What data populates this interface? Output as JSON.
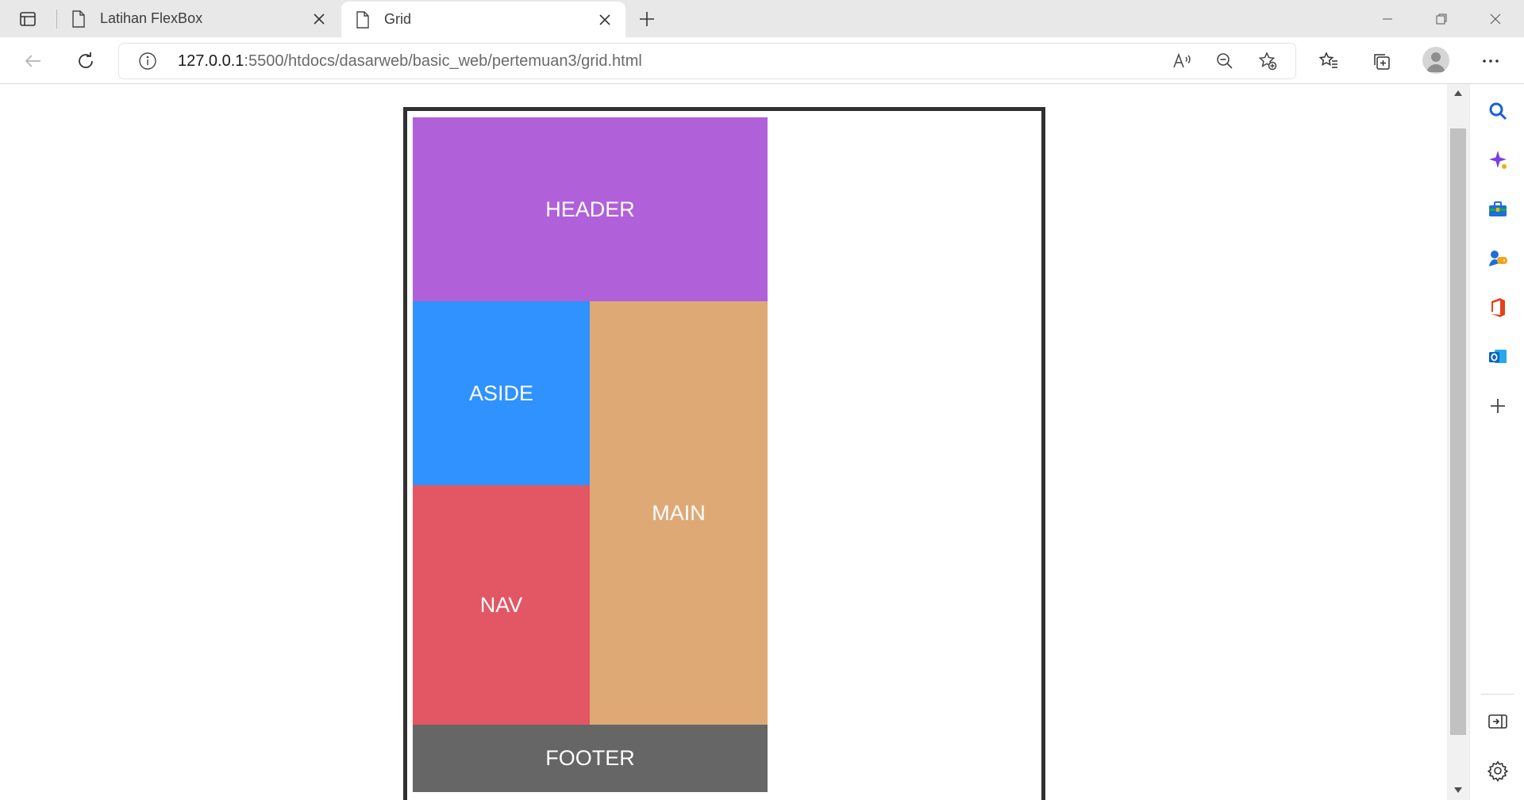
{
  "tabs": [
    {
      "title": "Latihan FlexBox",
      "active": false,
      "icon": "page-icon"
    },
    {
      "title": "Grid",
      "active": true,
      "icon": "page-icon"
    }
  ],
  "toolbar": {
    "url_host": "127.0.0.1",
    "url_rest": ":5500/htdocs/dasarweb/basic_web/pertemuan3/grid.html"
  },
  "grid": {
    "header": "HEADER",
    "aside": "ASIDE",
    "main": "MAIN",
    "nav": "NAV",
    "footer": "FOOTER"
  },
  "colors": {
    "header": "#b061da",
    "aside": "#2f92ff",
    "main": "#dfa975",
    "nav": "#e35764",
    "footer": "#666666",
    "container_border": "#303030"
  },
  "sidebar_icons": [
    "search-icon",
    "copilot-icon",
    "tools-icon",
    "games-icon",
    "office-icon",
    "outlook-icon",
    "add-icon",
    "split-screen-icon",
    "settings-icon"
  ]
}
